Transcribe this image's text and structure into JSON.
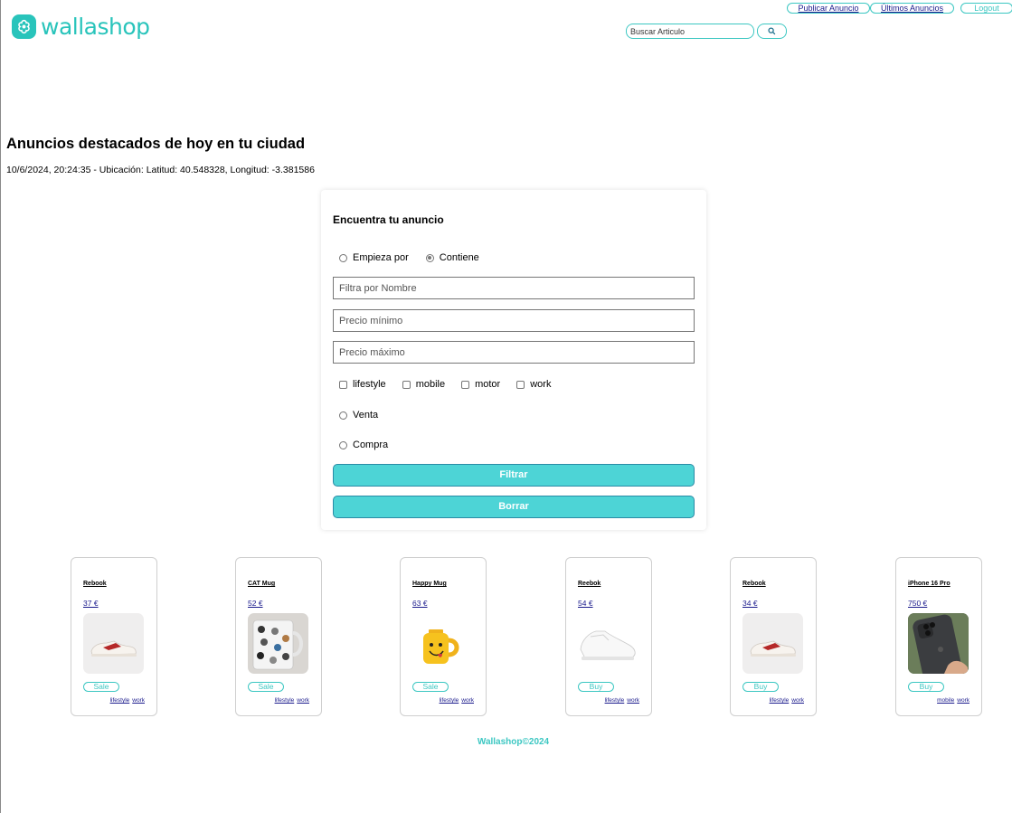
{
  "brand": {
    "name": "wallashop",
    "accent": "#29c4bb",
    "button_color": "#4dd4d6"
  },
  "nav": {
    "publish": "Publicar Anuncio",
    "latest": "Últimos Anuncios",
    "logout": "Logout"
  },
  "search": {
    "placeholder": "Buscar Articulo",
    "icon": "search-icon"
  },
  "page": {
    "title": "Anuncios destacados de hoy en tu ciudad",
    "subline": "10/6/2024, 20:24:35 - Ubicación: Latitud: 40.548328, Longitud: -3.381586"
  },
  "form": {
    "title": "Encuentra tu anuncio",
    "match_options": [
      {
        "label": "Empieza por",
        "checked": false
      },
      {
        "label": "Contiene",
        "checked": true
      }
    ],
    "name_placeholder": "Filtra por Nombre",
    "min_price_placeholder": "Precio mínimo",
    "max_price_placeholder": "Precio máximo",
    "tags": [
      "lifestyle",
      "mobile",
      "motor",
      "work"
    ],
    "sale_label": "Venta",
    "buy_label": "Compra",
    "filter_button": "Filtrar",
    "clear_button": "Borrar"
  },
  "products": [
    {
      "name": "Rebook",
      "price": "37 €",
      "action": "Sale",
      "tags": [
        "lifestyle",
        "work"
      ],
      "image": "sneaker-image"
    },
    {
      "name": "CAT Mug",
      "price": "52 €",
      "action": "Sale",
      "tags": [
        "lifestyle",
        "work"
      ],
      "image": "cat-mug-image"
    },
    {
      "name": "Happy Mug",
      "price": "63 €",
      "action": "Sale",
      "tags": [
        "lifestyle",
        "work"
      ],
      "image": "happy-mug-image"
    },
    {
      "name": "Reebok",
      "price": "54 €",
      "action": "Buy",
      "tags": [
        "lifestyle",
        "work"
      ],
      "image": "white-sneaker-image"
    },
    {
      "name": "Rebook",
      "price": "34 €",
      "action": "Buy",
      "tags": [
        "lifestyle",
        "work"
      ],
      "image": "sneaker-image"
    },
    {
      "name": "iPhone 16 Pro",
      "price": "750 €",
      "action": "Buy",
      "tags": [
        "mobile",
        "work"
      ],
      "image": "iphone-image"
    }
  ],
  "footer": "Wallashop©2024"
}
